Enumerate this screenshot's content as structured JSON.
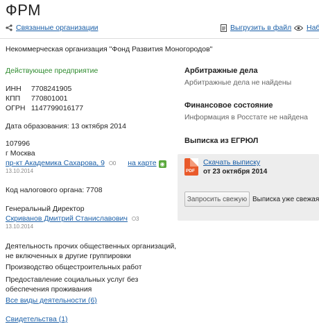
{
  "header": {
    "title": "ФРМ"
  },
  "toolbar": {
    "related": "Связанные организации",
    "export": "Выгрузить в файл",
    "watch": "Набл"
  },
  "org": {
    "full_name": "Некоммерческая организация \"Фонд Развития Моногородов\"",
    "status": "Действующее предприятие",
    "inn_label": "ИНН",
    "inn": "7708241905",
    "kpp_label": "КПП",
    "kpp": "770801001",
    "ogrn_label": "ОГРН",
    "ogrn": "1147799016177",
    "founded": "Дата образования: 13 октября 2014",
    "zip": "107996",
    "city": "г Москва",
    "street": "пр-кт Академика Сахарова, 9",
    "street_count": "0",
    "map_link": "на карте",
    "address_date": "13.10.2014",
    "tax_code": "Код налогового органа: 7708",
    "director_title": "Генеральный Директор",
    "director_name": "Скриванов Дмитрий Станиславович",
    "director_count": "3",
    "director_date": "13.10.2014",
    "activity1_line1": "Деятельность прочих общественных организаций,",
    "activity1_line2": "не включенных в другие группировки",
    "activity2": "Производство общестроительных работ",
    "activity3_line1": "Предоставление социальных услуг без",
    "activity3_line2": "обеспечения проживания",
    "all_activities": "Все виды деятельности (6)",
    "certificates": "Свидетельства (1)"
  },
  "right": {
    "arb_title": "Арбитражные дела",
    "arb_text": "Арбитражные дела не найдены",
    "fin_title": "Финансовое состояние",
    "fin_text": "Информация в Росстате не найдена",
    "egr_title": "Выписка из ЕГРЮЛ",
    "pdf_label": "PDF",
    "download": "Скачать выписку",
    "from_date": "от 23 октября 2014",
    "refresh_btn": "Запросить свежую",
    "fresh_note": "Выписка уже свежая"
  }
}
